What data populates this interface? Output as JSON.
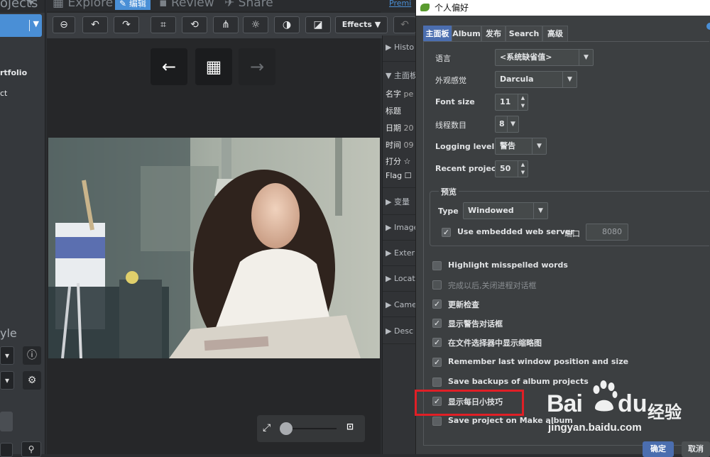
{
  "background_app": {
    "projects_label": "ojects",
    "left_items": [
      "rtfolio",
      "ct"
    ],
    "style_label": "yle",
    "tabs": {
      "explore": "Explore",
      "edit": "编辑",
      "review": "Review",
      "share": "Share",
      "premium": "Premi"
    },
    "toolbar": {
      "effects_label": "Effects"
    },
    "right_panel": {
      "sections": [
        "Histo",
        "主面板",
        "变量",
        "Image",
        "Exter",
        "Locat",
        "Came",
        "Desc"
      ],
      "fields": [
        {
          "label": "名字",
          "value": "pe"
        },
        {
          "label": "标题",
          "value": ""
        },
        {
          "label": "日期",
          "value": "20"
        },
        {
          "label": "时间",
          "value": "09"
        },
        {
          "label": "打分",
          "value": "☆"
        },
        {
          "label": "Flag",
          "value": ""
        }
      ]
    }
  },
  "dialog": {
    "title": "个人偏好",
    "tabs": [
      "主面板",
      "Album",
      "发布",
      "Search",
      "高级"
    ],
    "fields": {
      "language": {
        "label": "语言",
        "value": "<系统缺省值>"
      },
      "appearance": {
        "label": "外观感觉",
        "value": "Darcula"
      },
      "font_size": {
        "label": "Font size",
        "value": "11"
      },
      "threads": {
        "label": "线程数目",
        "value": "8"
      },
      "logging": {
        "label": "Logging level",
        "value": "警告"
      },
      "recent": {
        "label": "Recent projects",
        "value": "50"
      }
    },
    "preview": {
      "title": "预览",
      "type_label": "Type",
      "type_value": "Windowed",
      "embedded_label": "Use embedded web server",
      "embedded_checked": true,
      "port_label": "端口",
      "port_value": "8080"
    },
    "checkboxes": [
      {
        "label": "Highlight misspelled words",
        "checked": false,
        "enabled": true
      },
      {
        "label": "完成以后,关闭进程对话框",
        "checked": false,
        "enabled": false
      },
      {
        "label": "更新检查",
        "checked": true,
        "enabled": true
      },
      {
        "label": "显示警告对话框",
        "checked": true,
        "enabled": true
      },
      {
        "label": "在文件选择器中显示缩略图",
        "checked": true,
        "enabled": true
      },
      {
        "label": "Remember last window position and size",
        "checked": true,
        "enabled": true
      },
      {
        "label": "Save backups of album projects",
        "checked": false,
        "enabled": true
      },
      {
        "label": "显示每日小技巧",
        "checked": true,
        "enabled": true
      },
      {
        "label": "Save project on Make album",
        "checked": false,
        "enabled": true
      }
    ],
    "ok_label": "确定",
    "cancel_label": "取消"
  },
  "watermark": {
    "brand_bai": "Bai",
    "brand_du": "du",
    "brand_jy": "经验",
    "url": "jingyan.baidu.com"
  },
  "colors": {
    "accent": "#4a8fd6",
    "dialog_tab_active": "#4b6eaf",
    "highlight": "#e01f26"
  }
}
